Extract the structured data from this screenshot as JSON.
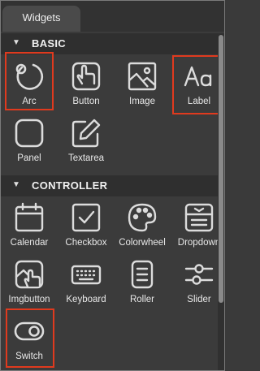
{
  "panel": {
    "tab_label": "Widgets",
    "sections": [
      {
        "title": "BASIC",
        "items": [
          {
            "label": "Arc",
            "icon": "arc-icon",
            "highlighted": true
          },
          {
            "label": "Button",
            "icon": "hand-pointer-icon",
            "highlighted": false
          },
          {
            "label": "Image",
            "icon": "image-icon",
            "highlighted": false
          },
          {
            "label": "Label",
            "icon": "label-text-icon",
            "highlighted": true
          },
          {
            "label": "Panel",
            "icon": "panel-icon",
            "highlighted": false
          },
          {
            "label": "Textarea",
            "icon": "edit-pencil-icon",
            "highlighted": false
          }
        ]
      },
      {
        "title": "CONTROLLER",
        "items": [
          {
            "label": "Calendar",
            "icon": "calendar-icon",
            "highlighted": false
          },
          {
            "label": "Checkbox",
            "icon": "checkbox-icon",
            "highlighted": false
          },
          {
            "label": "Colorwheel",
            "icon": "palette-icon",
            "highlighted": false
          },
          {
            "label": "Dropdown",
            "icon": "dropdown-icon",
            "highlighted": false
          },
          {
            "label": "Imgbutton",
            "icon": "image-button-icon",
            "highlighted": false
          },
          {
            "label": "Keyboard",
            "icon": "keyboard-icon",
            "highlighted": false
          },
          {
            "label": "Roller",
            "icon": "roller-icon",
            "highlighted": false
          },
          {
            "label": "Slider",
            "icon": "slider-icon",
            "highlighted": false
          },
          {
            "label": "Switch",
            "icon": "switch-icon",
            "highlighted": true
          }
        ]
      }
    ]
  },
  "colors": {
    "background": "#3b3b3b",
    "section_header": "#2f2f2f",
    "icon_stroke": "#dcdcdc",
    "highlight": "#e03a1e"
  }
}
